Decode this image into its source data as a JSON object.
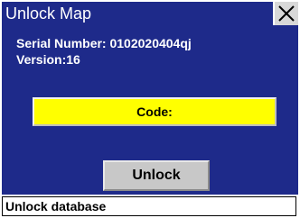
{
  "window": {
    "title": "Unlock Map",
    "close_icon": "close-icon"
  },
  "info": {
    "serial_number": "Serial Number: 0102020404qj",
    "version": "Version:16"
  },
  "code_field": {
    "label": "Code:",
    "value": ""
  },
  "actions": {
    "unlock_label": "Unlock"
  },
  "status": {
    "text": "Unlock database"
  },
  "colors": {
    "panel_background": "#1e2a8a",
    "code_field_background": "#ffff00",
    "button_background": "#c8c8c8"
  }
}
